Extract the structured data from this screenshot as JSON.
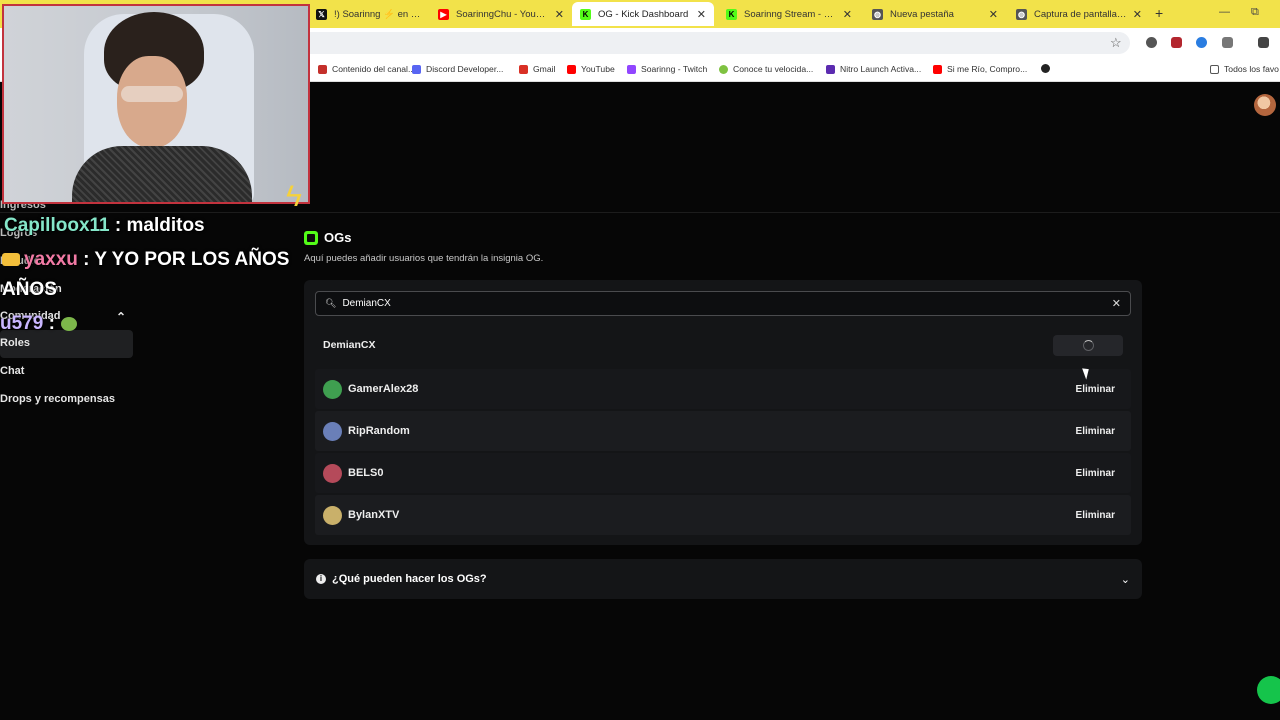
{
  "browser": {
    "tabs": [
      {
        "title": "!) Soarinng ⚡ en X: \"E",
        "icon_color": "#111111",
        "icon_glyph": "𝕏"
      },
      {
        "title": "SoarinngChu - YouTube",
        "icon_color": "#ff0000",
        "icon_glyph": "▶"
      },
      {
        "title": "OG - Kick Dashboard",
        "icon_color": "#53fc18",
        "icon_glyph": "K",
        "active": true
      },
      {
        "title": "Soarinng Stream - Watch",
        "icon_color": "#53fc18",
        "icon_glyph": "K"
      },
      {
        "title": "Nueva pestaña",
        "icon_color": "#555555",
        "icon_glyph": "◍"
      },
      {
        "title": "Captura de pantalla 2026",
        "icon_color": "#555555",
        "icon_glyph": "◍"
      }
    ],
    "close_glyph": "✕",
    "new_tab": "+",
    "minimize": "—",
    "restore": "⧉",
    "bookmarks": [
      {
        "label": "Contenido del canal...",
        "icon_color": "#c4302b"
      },
      {
        "label": "Discord Developer...",
        "icon_color": "#5865f2"
      },
      {
        "label": "Gmail",
        "icon_color": "#d93025"
      },
      {
        "label": "YouTube",
        "icon_color": "#ff0000"
      },
      {
        "label": "Soarinng - Twitch",
        "icon_color": "#9146ff"
      },
      {
        "label": "Conoce tu velocida...",
        "icon_color": "#7fc241"
      },
      {
        "label": "Nitro Launch Activa...",
        "icon_color": "#5b2bb0"
      },
      {
        "label": "Si me Río, Compro...",
        "icon_color": "#ff0000"
      },
      {
        "label": "",
        "icon_color": "#222222"
      }
    ],
    "all_bookmarks": "Todos los favo"
  },
  "sidebar": {
    "items": [
      "Ingresos",
      "Logros",
      "Estudio",
      "Moderación",
      "Comunidad",
      "Roles",
      "Chat",
      "Drops y recompensas"
    ],
    "active_index": 5,
    "community_chevron": "⌃"
  },
  "og_page": {
    "title": "OGs",
    "description": "Aquí puedes añadir usuarios que tendrán la insignia OG.",
    "search_value": "DemianCX",
    "search_icon": "search-icon",
    "clear_glyph": "✕",
    "result_name": "DemianCX",
    "og_users": [
      {
        "name": "GamerAlex28",
        "avatar_color": "#3f9f50",
        "action": "Eliminar"
      },
      {
        "name": "RipRandom",
        "avatar_color": "#6a7fb8",
        "action": "Eliminar"
      },
      {
        "name": "BELS0",
        "avatar_color": "#b54a5a",
        "action": "Eliminar"
      },
      {
        "name": "BylanXTV",
        "avatar_color": "#c9b06a",
        "action": "Eliminar"
      }
    ],
    "faq_title": "¿Qué pueden hacer los OGs?",
    "faq_chevron": "⌄",
    "info_glyph": "i"
  },
  "stream_chat": {
    "lines": [
      {
        "user": "Capilloox11",
        "message": " : malditos"
      },
      {
        "user": "yaxxu",
        "message": " : Y YO POR LOS AÑOS"
      },
      {
        "user": "",
        "message": "AÑOS"
      },
      {
        "user": "u579",
        "message": " :"
      }
    ]
  },
  "colors": {
    "kick_green": "#53fc18",
    "webcam_border": "#c2333e",
    "tabbar": "#f2e24a"
  }
}
